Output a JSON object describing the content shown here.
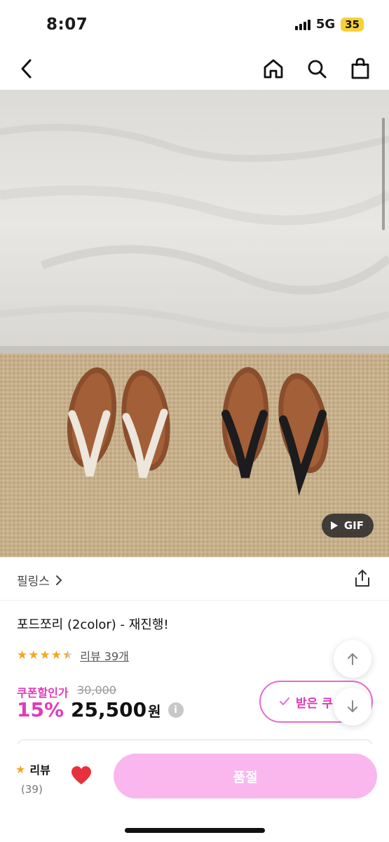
{
  "status_bar": {
    "time": "8:07",
    "network": "5G",
    "battery": "35"
  },
  "nav": {
    "back_icon": "chevron-left-icon",
    "home_icon": "home-icon",
    "search_icon": "search-icon",
    "cart_icon": "shopping-bag-icon"
  },
  "image": {
    "gif_label": "GIF"
  },
  "brand": {
    "name": "필링스",
    "chevron": "›"
  },
  "product": {
    "title": "포드쪼리 (2color) - 재진행!",
    "rating": 4.5,
    "review_text": "리뷰 39개",
    "coupon_label": "쿠폰할인가",
    "original_price": "30,000",
    "discount": "15%",
    "price": "25,500",
    "currency": "원",
    "info_mark": "i",
    "coupon_button_label": "받은 쿠"
  },
  "bottom": {
    "review_label": "리뷰",
    "review_count": "(39)",
    "buy_label": "품절"
  },
  "colors": {
    "accent_pink": "#e23ab9",
    "soldout_pink": "#f9b7ee",
    "star": "#f5a623",
    "heart": "#e8313d"
  }
}
